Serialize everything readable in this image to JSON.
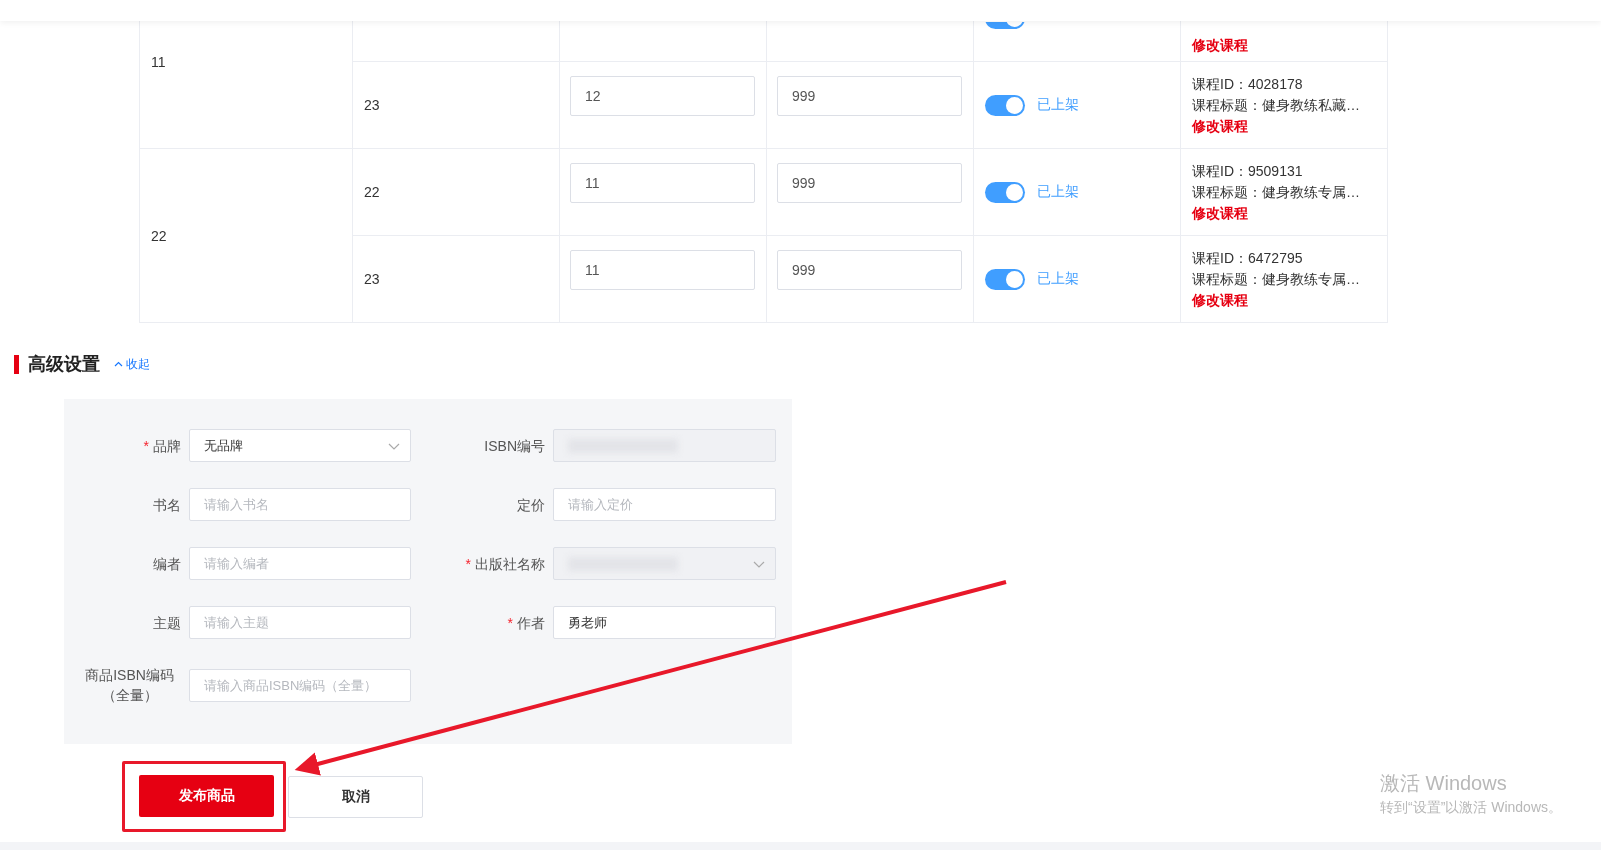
{
  "sku_table": {
    "groups": [
      {
        "label": "11",
        "rows": [
          {
            "on": true,
            "edit_link": "修改课程"
          },
          {
            "sku": "23",
            "stock": "12",
            "price": "999",
            "on": true,
            "status": "已上架",
            "course_id": "课程ID：4028178",
            "course_title": "课程标题：健身教练私藏…",
            "edit_link": "修改课程"
          }
        ]
      },
      {
        "label": "22",
        "rows": [
          {
            "sku": "22",
            "stock": "11",
            "price": "999",
            "on": true,
            "status": "已上架",
            "course_id": "课程ID：9509131",
            "course_title": "课程标题：健身教练专属…",
            "edit_link": "修改课程"
          },
          {
            "sku": "23",
            "stock": "11",
            "price": "999",
            "on": true,
            "status": "已上架",
            "course_id": "课程ID：6472795",
            "course_title": "课程标题：健身教练专属…",
            "edit_link": "修改课程"
          }
        ]
      }
    ]
  },
  "advanced": {
    "title": "高级设置",
    "collapse_link": "收起",
    "expanded": true,
    "fields": [
      {
        "label": "品牌",
        "required_mark": "*",
        "kind": "select",
        "value": "无品牌"
      },
      {
        "label": "ISBN编号",
        "kind": "redacted",
        "disabled": true
      },
      {
        "label": "书名",
        "kind": "input",
        "placeholder": "请输入书名"
      },
      {
        "label": "定价",
        "kind": "input",
        "placeholder": "请输入定价"
      },
      {
        "label": "编者",
        "kind": "input",
        "placeholder": "请输入编者"
      },
      {
        "label": "出版社名称",
        "required_mark": "*",
        "kind": "redacted_select",
        "disabled": true
      },
      {
        "label": "主题",
        "kind": "input",
        "placeholder": "请输入主题"
      },
      {
        "label": "作者",
        "required_mark": "*",
        "kind": "input",
        "value": "勇老师"
      },
      {
        "label": "商品ISBN编码（全量）",
        "kind": "input",
        "placeholder": "请输入商品ISBN编码（全量）"
      }
    ]
  },
  "actions": {
    "publish": "发布商品",
    "cancel": "取消",
    "publish_highlighted": true
  },
  "os_notice": {
    "title": "激活 Windows",
    "subtitle": "转到“设置”以激活 Windows。"
  }
}
